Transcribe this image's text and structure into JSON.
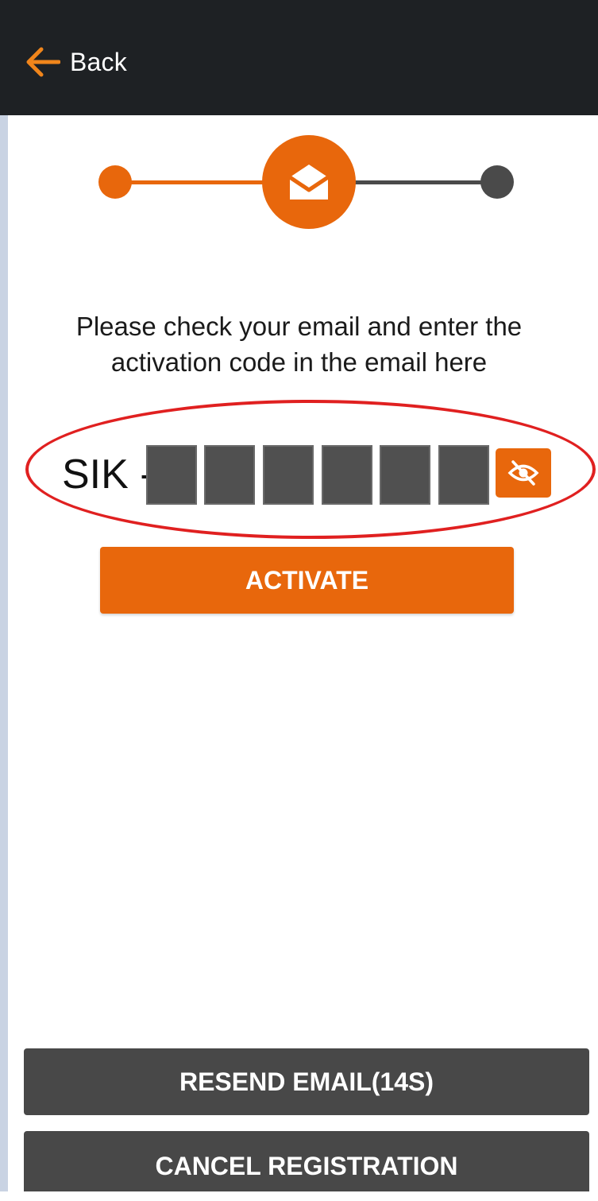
{
  "header": {
    "back_label": "Back"
  },
  "stepper": {
    "steps": [
      "complete",
      "current",
      "pending"
    ],
    "current_step_icon": "open-envelope-icon"
  },
  "instructions": {
    "line1": "Please check your email and enter the",
    "line2": "activation code in the email here"
  },
  "code_entry": {
    "prefix": "SIK -",
    "box_count": 6,
    "toggle_icon": "eye-off-icon"
  },
  "buttons": {
    "activate": "ACTIVATE",
    "resend": "RESEND EMAIL(14S)",
    "cancel": "CANCEL REGISTRATION"
  },
  "colors": {
    "accent": "#e8670c",
    "topbar": "#1e2124",
    "dark_button": "#484848",
    "code_box": "#505050",
    "highlight": "#e02020"
  }
}
